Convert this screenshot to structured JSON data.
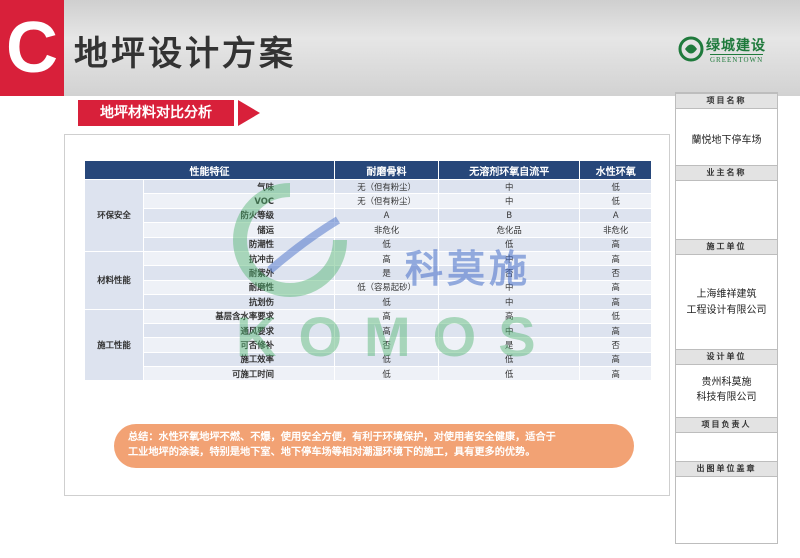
{
  "header": {
    "badge": "C",
    "title": "地坪设计方案",
    "logo_cn": "绿城建设",
    "logo_en": "GREENTOWN"
  },
  "section": {
    "title": "地坪材料对比分析"
  },
  "table": {
    "headers": [
      "性能特征",
      "耐磨骨料",
      "无溶剂环氧自流平",
      "水性环氧"
    ],
    "groups": [
      {
        "name": "环保安全",
        "rows": [
          {
            "feature": "气味",
            "vals": [
              "无（但有粉尘）",
              "中",
              "低"
            ]
          },
          {
            "feature": "VOC",
            "vals": [
              "无（但有粉尘）",
              "中",
              "低"
            ]
          },
          {
            "feature": "防火等级",
            "vals": [
              "A",
              "B",
              "A"
            ]
          },
          {
            "feature": "储运",
            "vals": [
              "非危化",
              "危化品",
              "非危化"
            ]
          },
          {
            "feature": "防潮性",
            "vals": [
              "低",
              "低",
              "高"
            ]
          }
        ]
      },
      {
        "name": "材料性能",
        "rows": [
          {
            "feature": "抗冲击",
            "vals": [
              "高",
              "中",
              "高"
            ]
          },
          {
            "feature": "耐紫外",
            "vals": [
              "是",
              "否",
              "否"
            ]
          },
          {
            "feature": "耐磨性",
            "vals": [
              "低（容易起砂）",
              "中",
              "高"
            ]
          },
          {
            "feature": "抗划伤",
            "vals": [
              "低",
              "中",
              "高"
            ]
          }
        ]
      },
      {
        "name": "施工性能",
        "rows": [
          {
            "feature": "基层含水率要求",
            "vals": [
              "高",
              "高",
              "低"
            ]
          },
          {
            "feature": "通风要求",
            "vals": [
              "高",
              "中",
              "高"
            ]
          },
          {
            "feature": "可否修补",
            "vals": [
              "否",
              "是",
              "否"
            ]
          },
          {
            "feature": "施工效率",
            "vals": [
              "低",
              "低",
              "高"
            ]
          },
          {
            "feature": "可施工时间",
            "vals": [
              "低",
              "低",
              "高"
            ]
          }
        ]
      }
    ]
  },
  "watermark": {
    "cn": "科莫施",
    "en": "KOMOS"
  },
  "summary": {
    "line1": "总结：水性环氧地坪不燃、不爆，使用安全方便，有利于环境保护，对使用者安全健康，适合于",
    "line2": "工业地坪的涂装，特别是地下室、地下停车场等相对潮湿环境下的施工，具有更多的优势。"
  },
  "sidebar": {
    "project_name_label": "项目名称",
    "project_name": "蘭悦地下停车场",
    "owner_label": "业主名称",
    "owner": "",
    "contractor_label": "施工单位",
    "contractor_1": "上海维祥建筑",
    "contractor_2": "工程设计有限公司",
    "designer_label": "设计单位",
    "designer_1": "贵州科莫施",
    "designer_2": "科技有限公司",
    "manager_label": "项目负责人",
    "manager": "",
    "stamp_label": "出图单位盖章"
  },
  "colors": {
    "accent": "#d8203a",
    "table_header": "#27477a",
    "summary_bg": "#f2a274",
    "logo_green": "#1f7a3c"
  }
}
